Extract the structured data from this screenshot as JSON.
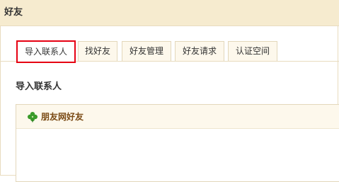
{
  "header": {
    "title": "好友"
  },
  "tabs": [
    {
      "label": "导入联系人",
      "active": true
    },
    {
      "label": "找好友",
      "active": false
    },
    {
      "label": "好友管理",
      "active": false
    },
    {
      "label": "好友请求",
      "active": false
    },
    {
      "label": "认证空间",
      "active": false
    }
  ],
  "section": {
    "title": "导入联系人"
  },
  "box": {
    "title": "朋友网好友",
    "icon": "clover-icon"
  },
  "colors": {
    "header_bg": "#f6ebcf",
    "border": "#e8dcbf",
    "active_tab_border": "#e60012",
    "box_title": "#7a4a14",
    "icon_green": "#3a9b2a"
  }
}
